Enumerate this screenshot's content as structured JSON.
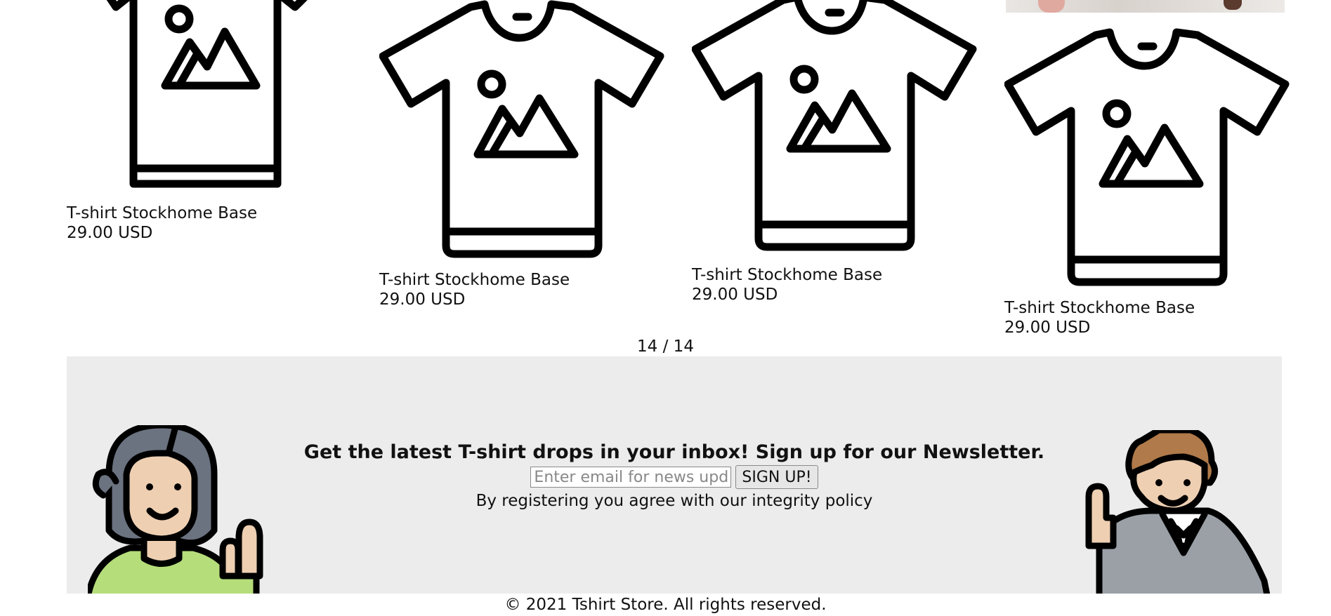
{
  "products": [
    {
      "name": "T-shirt Stockhome Base",
      "price": "29.00 USD"
    },
    {
      "name": "T-shirt Stockhome Base",
      "price": "29.00 USD"
    },
    {
      "name": "T-shirt Stockhome Base",
      "price": "29.00 USD"
    },
    {
      "name": "T-shirt Stockhome Base",
      "price": "29.00 USD"
    }
  ],
  "pagination": {
    "label": "14 / 14"
  },
  "newsletter": {
    "heading": "Get the latest T-shirt drops in your inbox! Sign up for our Newsletter.",
    "email_placeholder": "Enter email for news updates",
    "button_label": "SIGN UP!",
    "note": "By registering you agree with our integrity policy"
  },
  "footer": {
    "copyright": "© 2021 Tshirt Store. All rights reserved."
  },
  "icons": {
    "product_image": "tshirt-image-placeholder-icon",
    "avatar_left": "woman-waving-avatar",
    "avatar_right": "man-waving-avatar"
  },
  "colors": {
    "newsletter_bg": "#ececec",
    "text": "#111111"
  }
}
